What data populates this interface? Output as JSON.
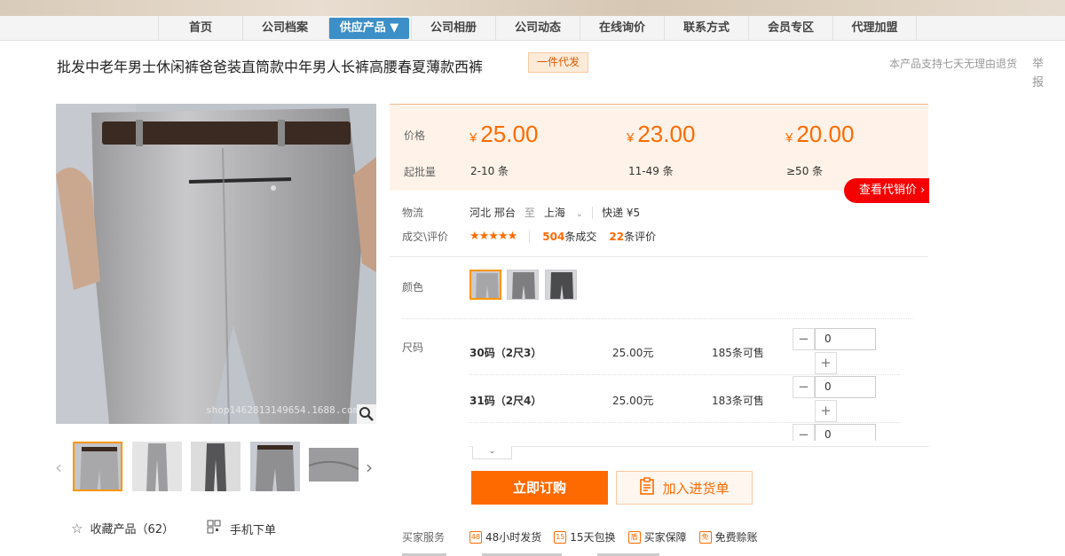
{
  "nav": {
    "items": [
      "首页",
      "公司档案",
      "供应产品 ▼",
      "公司相册",
      "公司动态",
      "在线询价",
      "联系方式",
      "会员专区",
      "代理加盟"
    ],
    "active_index": 2
  },
  "product": {
    "title": "批发中老年男士休闲裤爸爸装直筒款中年男人长裤高腰春夏薄款西裤",
    "tag": "一件代发",
    "return_note": "本产品支持七天无理由退货",
    "report": "举报"
  },
  "gallery": {
    "watermark": "shop1462813149654.1688.com",
    "prev_icon": "chevron-left-icon",
    "next_icon": "chevron-right-icon",
    "zoom_icon": "magnifier-icon"
  },
  "actions": {
    "collect_label": "收藏产品（62）",
    "mobile_label": "手机下单",
    "order_label": "立即订购",
    "cart_label": "加入进货单"
  },
  "pricing": {
    "price_label": "价格",
    "batch_label": "起批量",
    "currency": "¥",
    "tiers": [
      {
        "price": "25.00",
        "qty": "2-10 条"
      },
      {
        "price": "23.00",
        "qty": "11-49 条"
      },
      {
        "price": "20.00",
        "qty": "≥50 条"
      }
    ],
    "agent_button": "查看代销价"
  },
  "logistics": {
    "label": "物流",
    "from": "河北 邢台",
    "to_word": "至",
    "to": "上海",
    "shipping": "快递 ¥5"
  },
  "deals": {
    "label": "成交\\评价",
    "rating": 4.5,
    "stars": "★★★★★",
    "deal_count": "504",
    "deal_unit": "条成交",
    "review_count": "22",
    "review_unit": "条评价"
  },
  "color": {
    "label": "颜色",
    "selected_index": 0,
    "swatch_count": 3
  },
  "sizes": {
    "label": "尺码",
    "rows": [
      {
        "name": "30码（2尺3）",
        "price": "25.00元",
        "stock": "185条可售",
        "qty": "0"
      },
      {
        "name": "31码（2尺4）",
        "price": "25.00元",
        "stock": "183条可售",
        "qty": "0"
      },
      {
        "qty": "0"
      }
    ],
    "minus": "−",
    "plus": "+",
    "expand": "⌄"
  },
  "services": {
    "label": "买家服务",
    "items": [
      {
        "icon": "48",
        "label": "48小时发货"
      },
      {
        "icon": "15",
        "label": "15天包换"
      },
      {
        "icon": "盾",
        "label": "买家保障"
      },
      {
        "icon": "免",
        "label": "免费赊账"
      }
    ]
  },
  "colors": {
    "accent": "#ff6a00",
    "nav_active": "#3c8fc7",
    "agent_red": "#f50000"
  }
}
